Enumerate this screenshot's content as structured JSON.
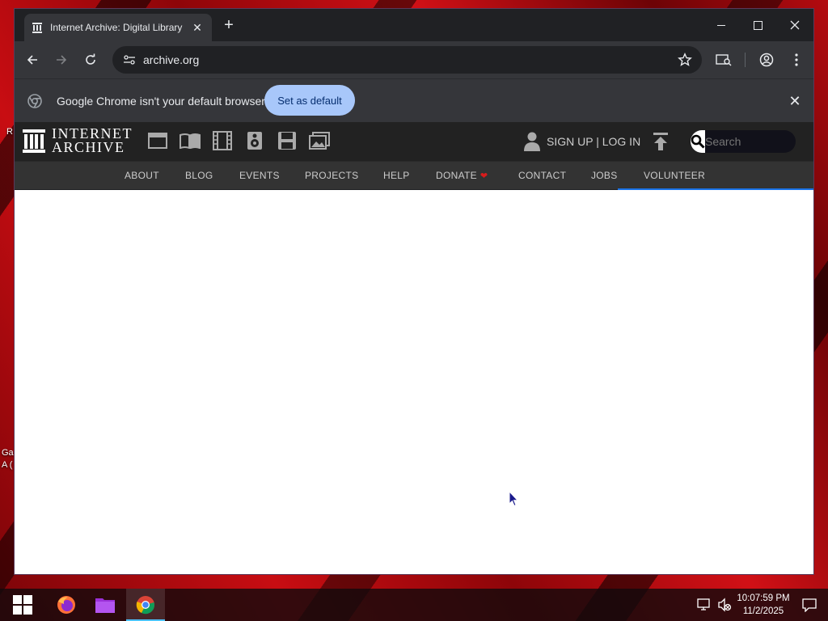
{
  "desktop": {
    "edge_labels": [
      "R",
      "Ga",
      "A ("
    ]
  },
  "browser": {
    "tab": {
      "title": "Internet Archive: Digital Library"
    },
    "address": {
      "url": "archive.org"
    },
    "infobar": {
      "message": "Google Chrome isn't your default browser",
      "button_label": "Set as default"
    }
  },
  "ia": {
    "logo_line1": "INTERNET",
    "logo_line2": "ARCHIVE",
    "media_icons": [
      "web-icon",
      "texts-icon",
      "video-icon",
      "audio-icon",
      "software-icon",
      "images-icon"
    ],
    "signup_label": "SIGN UP | LOG IN",
    "search_placeholder": "Search",
    "nav": {
      "items": [
        {
          "label": "ABOUT"
        },
        {
          "label": "BLOG"
        },
        {
          "label": "EVENTS"
        },
        {
          "label": "PROJECTS"
        },
        {
          "label": "HELP"
        },
        {
          "label": "DONATE"
        },
        {
          "label": "CONTACT"
        },
        {
          "label": "JOBS"
        },
        {
          "label": "VOLUNTEER"
        }
      ]
    },
    "colors": {
      "header": "#222222",
      "nav": "#333333",
      "heart": "#d91c1c",
      "progress": "#1a73e8"
    }
  },
  "taskbar": {
    "apps": [
      "start-icon",
      "firefox-icon",
      "file-explorer-icon",
      "chrome-icon"
    ],
    "clock": {
      "time": "10:07:59 PM",
      "date": "11/2/2025"
    }
  }
}
